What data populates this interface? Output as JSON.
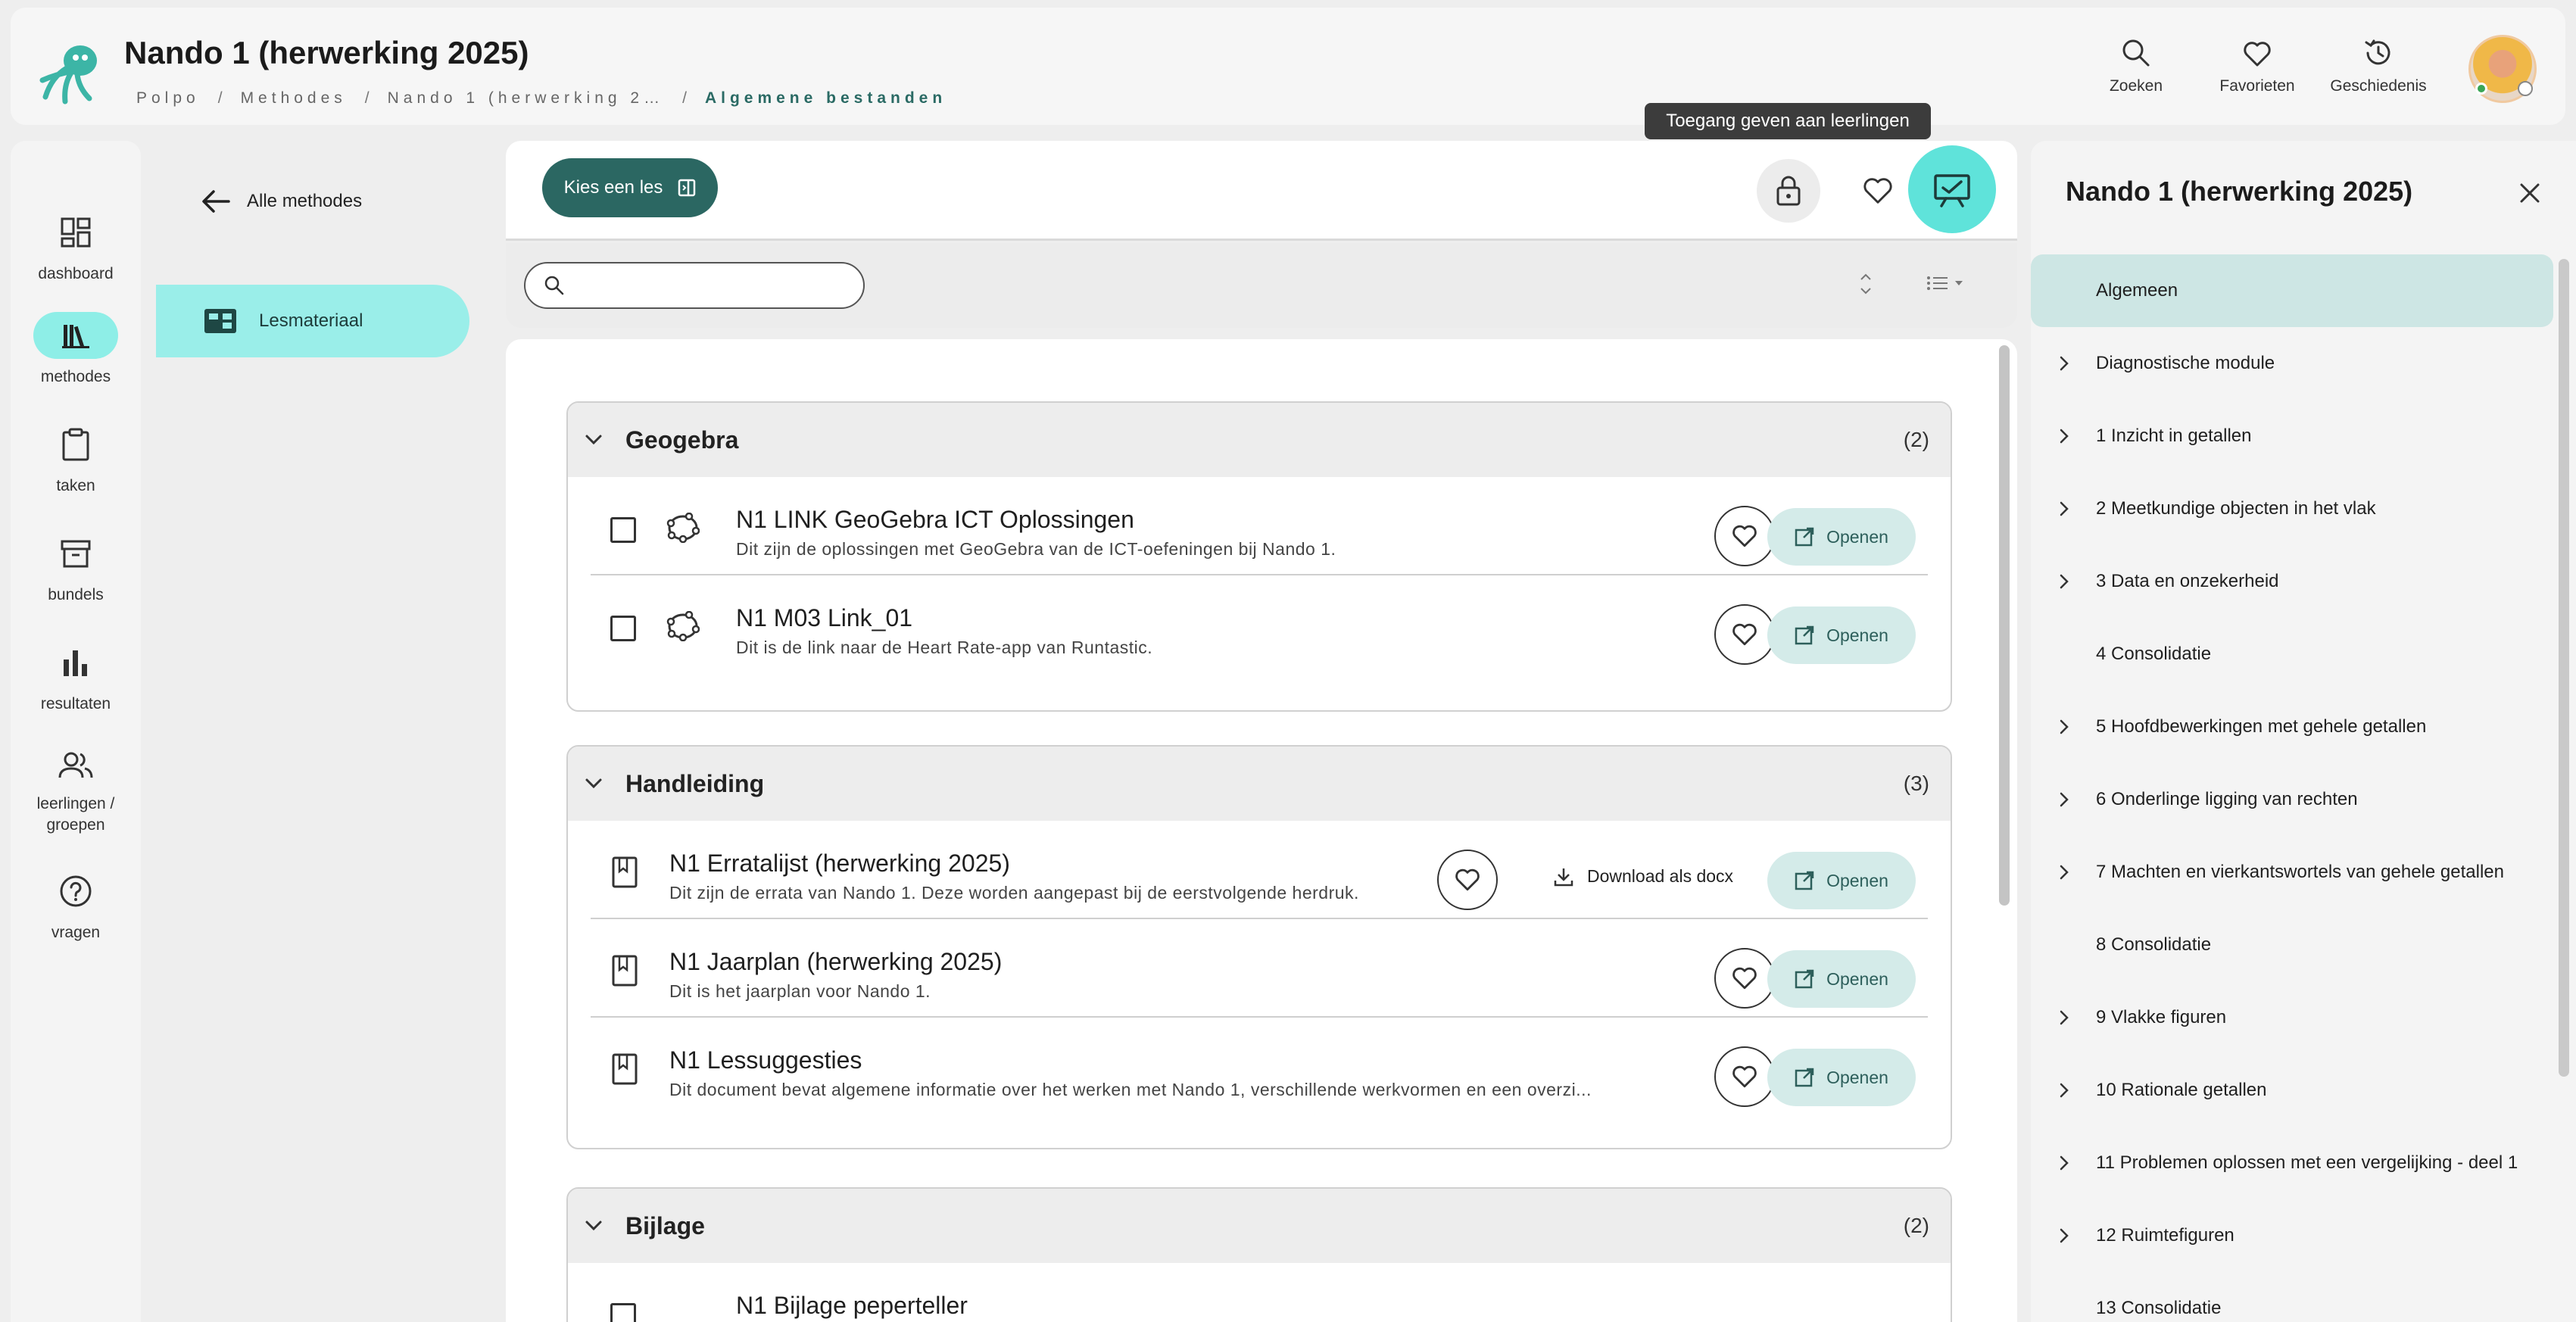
{
  "header": {
    "title": "Nando 1 (herwerking 2025)",
    "breadcrumb": [
      "Polpo",
      "Methodes",
      "Nando 1 (herwerking 2…",
      "Algemene bestanden"
    ],
    "breadcrumb_sep": "/",
    "actions": {
      "search": "Zoeken",
      "favorites": "Favorieten",
      "history": "Geschiedenis"
    }
  },
  "leftnav": {
    "items": [
      {
        "label": "dashboard",
        "icon": "dashboard-icon"
      },
      {
        "label": "methodes",
        "icon": "books-icon",
        "active": true
      },
      {
        "label": "taken",
        "icon": "clipboard-icon"
      },
      {
        "label": "bundels",
        "icon": "archive-icon"
      },
      {
        "label": "resultaten",
        "icon": "bar-chart-icon"
      },
      {
        "label": "leerlingen / groepen",
        "icon": "people-icon"
      },
      {
        "label": "vragen",
        "icon": "help-icon"
      }
    ]
  },
  "subnav": {
    "back_label": "Alle methodes",
    "active_label": "Lesmateriaal"
  },
  "toolbar": {
    "kies_label": "Kies een les",
    "tooltip": "Toegang geven aan leerlingen"
  },
  "search": {
    "placeholder": "",
    "value": ""
  },
  "groups": [
    {
      "title": "Geogebra",
      "count": "(2)",
      "items": [
        {
          "title": "N1 LINK GeoGebra ICT Oplossingen",
          "desc": "Dit zijn de oplossingen met GeoGebra van de ICT-oefeningen bij Nando 1.",
          "open": "Openen"
        },
        {
          "title": "N1 M03 Link_01",
          "desc": "Dit is de link naar de Heart Rate-app van Runtastic.",
          "open": "Openen"
        }
      ]
    },
    {
      "title": "Handleiding",
      "count": "(3)",
      "items": [
        {
          "title": "N1 Erratalijst (herwerking 2025)",
          "desc": "Dit zijn de errata van Nando 1. Deze worden aangepast bij de eerstvolgende herdruk.",
          "download": "Download als docx",
          "open": "Openen"
        },
        {
          "title": "N1 Jaarplan (herwerking 2025)",
          "desc": "Dit is het jaarplan voor Nando 1.",
          "open": "Openen"
        },
        {
          "title": "N1 Lessuggesties",
          "desc": "Dit document bevat algemene informatie over het werken met Nando 1, verschillende werkvormen en een overzi...",
          "open": "Openen"
        }
      ]
    },
    {
      "title": "Bijlage",
      "count": "(2)",
      "items": [
        {
          "title": "N1 Bijlage peperteller"
        }
      ]
    }
  ],
  "rpanel": {
    "title": "Nando 1 (herwerking 2025)",
    "items": [
      {
        "label": "Algemeen",
        "active": true,
        "expandable": false
      },
      {
        "label": "Diagnostische module",
        "expandable": true
      },
      {
        "label": "1 Inzicht in getallen",
        "expandable": true
      },
      {
        "label": "2 Meetkundige objecten in het vlak",
        "expandable": true
      },
      {
        "label": "3 Data en onzekerheid",
        "expandable": true
      },
      {
        "label": "4 Consolidatie",
        "expandable": false
      },
      {
        "label": "5 Hoofdbewerkingen met gehele getallen",
        "expandable": true
      },
      {
        "label": "6 Onderlinge ligging van rechten",
        "expandable": true
      },
      {
        "label": "7 Machten en vierkantswortels van gehele getallen",
        "expandable": true
      },
      {
        "label": "8 Consolidatie",
        "expandable": false
      },
      {
        "label": "9 Vlakke figuren",
        "expandable": true
      },
      {
        "label": "10 Rationale getallen",
        "expandable": true
      },
      {
        "label": "11 Problemen oplossen met een vergelijking - deel 1",
        "expandable": true
      },
      {
        "label": "12 Ruimtefiguren",
        "expandable": true
      },
      {
        "label": "13 Consolidatie",
        "expandable": false
      }
    ]
  },
  "colors": {
    "accent": "#5fe3da",
    "primary_dark": "#2b6762",
    "active_bg": "#9aeee9",
    "open_btn_bg": "#d4ebe9"
  }
}
